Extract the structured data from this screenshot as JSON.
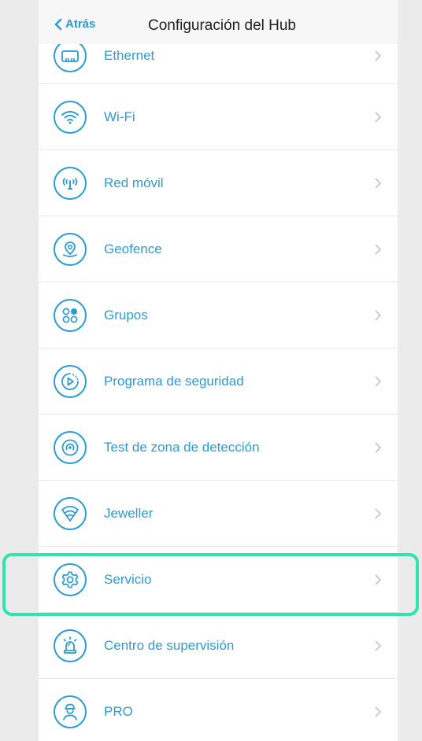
{
  "navbar": {
    "back_label": "Atrás",
    "title": "Configuración del Hub"
  },
  "colors": {
    "accent": "#2a9bd5",
    "highlight": "#2de5ad",
    "background": "#ebebeb"
  },
  "menu": {
    "items": [
      {
        "label": "Ethernet",
        "icon": "ethernet-icon"
      },
      {
        "label": "Wi-Fi",
        "icon": "wifi-icon"
      },
      {
        "label": "Red móvil",
        "icon": "cellular-antenna-icon"
      },
      {
        "label": "Geofence",
        "icon": "location-pin-icon"
      },
      {
        "label": "Grupos",
        "icon": "groups-icon"
      },
      {
        "label": "Programa de seguridad",
        "icon": "security-schedule-icon"
      },
      {
        "label": "Test de zona de detección",
        "icon": "detection-zone-icon"
      },
      {
        "label": "Jeweller",
        "icon": "jeweller-icon"
      },
      {
        "label": "Servicio",
        "icon": "gear-icon",
        "highlighted": true
      },
      {
        "label": "Centro de supervisión",
        "icon": "alarm-beacon-icon"
      },
      {
        "label": "PRO",
        "icon": "pro-user-icon"
      }
    ]
  }
}
